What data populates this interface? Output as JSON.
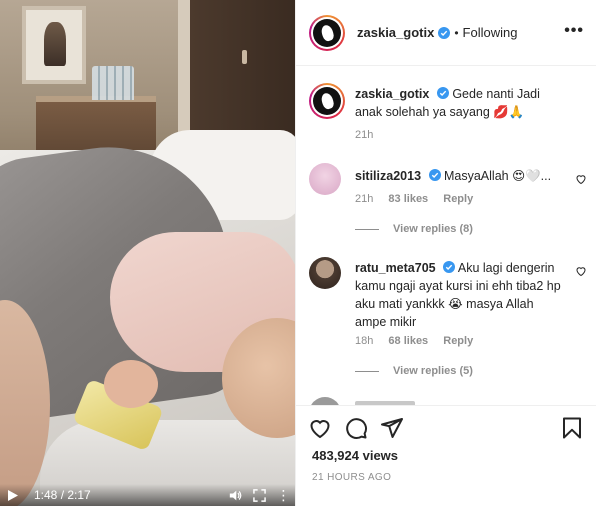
{
  "video": {
    "time_current": "1:48",
    "time_total": "2:17",
    "time_sep": " / ",
    "icons": [
      "play-icon",
      "volume-icon",
      "fullscreen-icon",
      "more-vertical-icon"
    ]
  },
  "post": {
    "username": "zaskia_gotix",
    "separator": "•",
    "follow_status": "Following",
    "more_label": "•••"
  },
  "caption": {
    "username": "zaskia_gotix",
    "text": "Gede nanti Jadi anak solehah ya sayang 💋🙏",
    "time": "21h"
  },
  "comments": [
    {
      "username": "sitiliza2013",
      "text": "MasyaAllah 😍🤍...",
      "time": "21h",
      "likes": "83 likes",
      "reply": "Reply",
      "view_replies": "View replies (8)"
    },
    {
      "username": "ratu_meta705",
      "text": "Aku lagi dengerin kamu ngaji ayat kursi ini ehh tiba2 hp aku mati yankkk 😭 masya Allah ampe mikir",
      "time": "18h",
      "likes": "68 likes",
      "reply": "Reply",
      "view_replies": "View replies (5)"
    }
  ],
  "footer": {
    "views": "483,924 views",
    "time_ago": "21 HOURS AGO"
  },
  "colors": {
    "verified": "#3897f0",
    "text": "#262626",
    "secondary": "#8e8e8e",
    "border": "#efefef"
  }
}
